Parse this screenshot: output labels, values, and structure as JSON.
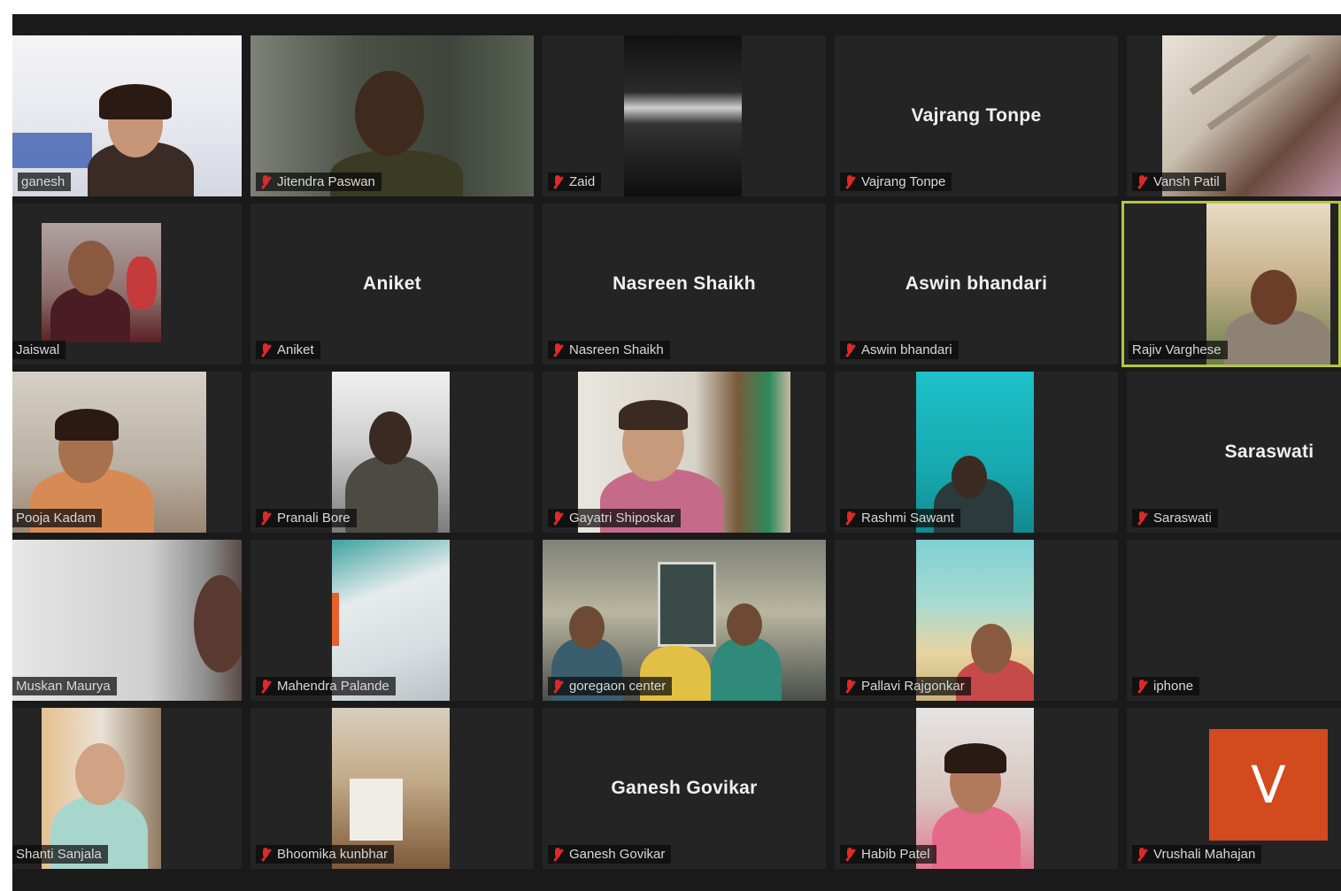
{
  "meeting": {
    "participants": [
      {
        "name": "ganesh",
        "video": true
      },
      {
        "name": "Jitendra Paswan",
        "video": true
      },
      {
        "name": "Zaid",
        "video": true
      },
      {
        "name": "Vajrang Tonpe",
        "video": false
      },
      {
        "name": "Vansh Patil",
        "video": true
      },
      {
        "name": "Jaiswal",
        "video": true
      },
      {
        "name": "Aniket",
        "video": false
      },
      {
        "name": "Nasreen Shaikh",
        "video": false
      },
      {
        "name": "Aswin bhandari",
        "video": false
      },
      {
        "name": "Rajiv Varghese",
        "video": true,
        "active_speaker": true
      },
      {
        "name": "Pooja Kadam",
        "video": true
      },
      {
        "name": "Pranali Bore",
        "video": true
      },
      {
        "name": "Gayatri Shiposkar",
        "video": true
      },
      {
        "name": "Rashmi Sawant",
        "video": true
      },
      {
        "name": "Saraswati",
        "video": false
      },
      {
        "name": "Muskan Maurya",
        "video": true
      },
      {
        "name": "Mahendra Palande",
        "video": true
      },
      {
        "name": "goregaon center",
        "video": true
      },
      {
        "name": "Pallavi Rajgonkar",
        "video": true
      },
      {
        "name": "iphone",
        "video": false
      },
      {
        "name": "Shanti Sanjala",
        "video": true
      },
      {
        "name": "Bhoomika kunbhar",
        "video": true
      },
      {
        "name": "Ganesh Govikar",
        "video": false
      },
      {
        "name": "Habib Patel",
        "video": true
      },
      {
        "name": "Vrushali Mahajan",
        "video": false,
        "avatar_letter": "V",
        "avatar_color": "#d34a1f"
      }
    ]
  }
}
